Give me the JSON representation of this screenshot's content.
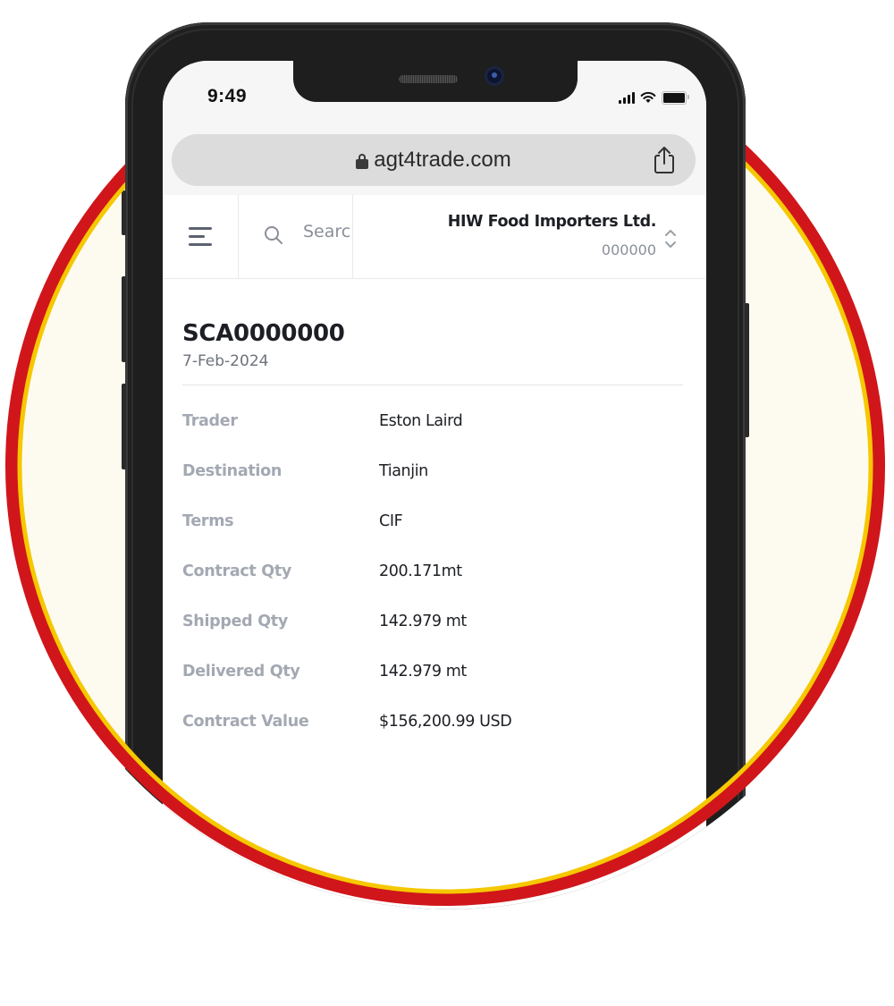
{
  "status_bar": {
    "time": "9:49",
    "icons": [
      "signal-icon",
      "wifi-icon",
      "battery-icon"
    ]
  },
  "browser": {
    "url": "agt4trade.com",
    "lock_icon": "lock-icon",
    "share_icon": "share-icon"
  },
  "header": {
    "menu_icon": "hamburger-menu-icon",
    "search": {
      "placeholder": "Search",
      "value": ""
    },
    "company": {
      "name": "HIW Food Importers Ltd.",
      "code": "000000",
      "toggle_icon": "chevron-updown-icon"
    }
  },
  "contract": {
    "id": "SCA0000000",
    "date": "7-Feb-2024",
    "fields": [
      {
        "label": "Trader",
        "value": "Eston Laird"
      },
      {
        "label": "Destination",
        "value": "Tianjin"
      },
      {
        "label": "Terms",
        "value": "CIF"
      },
      {
        "label": "Contract Qty",
        "value": "200.171mt"
      },
      {
        "label": "Shipped Qty",
        "value": "142.979 mt"
      },
      {
        "label": "Delivered Qty",
        "value": "142.979 mt"
      },
      {
        "label": "Contract Value",
        "value": "$156,200.99  USD"
      }
    ]
  },
  "colors": {
    "ring_outer": "#d0161b",
    "ring_inner": "#f5c800",
    "circle_fill": "#fdfbef",
    "phone_body": "#1e1e1e"
  }
}
